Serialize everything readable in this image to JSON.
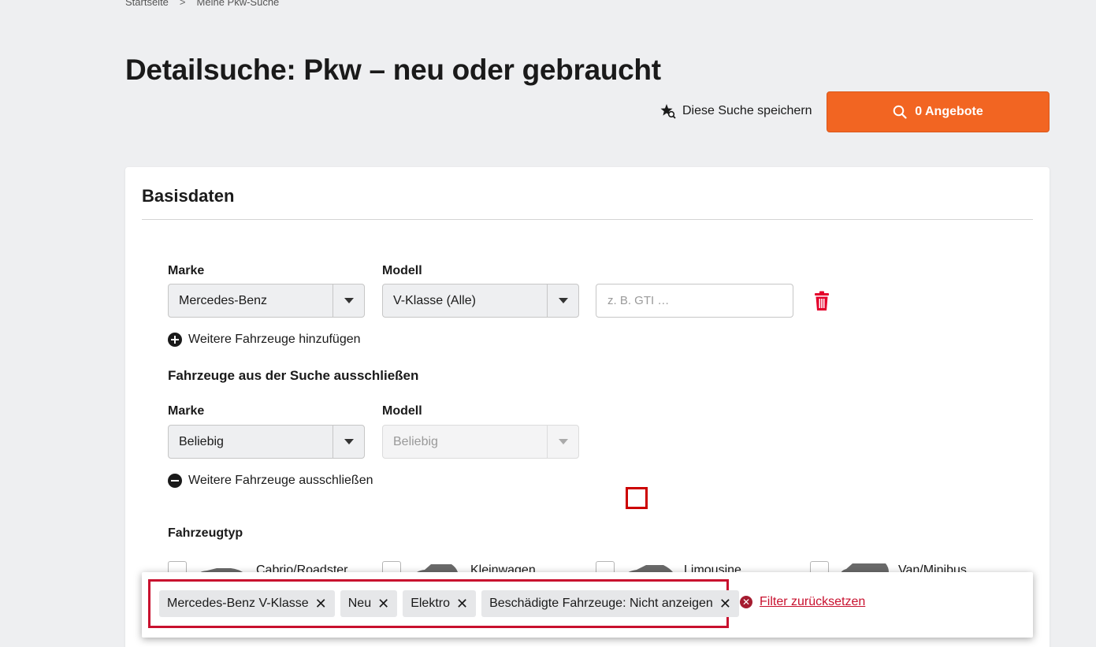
{
  "breadcrumb": {
    "home": "Startseite",
    "separator": ">",
    "current": "Meine Pkw-Suche"
  },
  "page_title": "Detailsuche: Pkw – neu oder gebraucht",
  "save_search_label": "Diese Suche speichern",
  "offers_button_label": "0 Angebote",
  "card": {
    "title": "Basisdaten",
    "include": {
      "marke_label": "Marke",
      "marke_value": "Mercedes-Benz",
      "modell_label": "Modell",
      "modell_value": "V-Klasse (Alle)",
      "variant_placeholder": "z. B. GTI …",
      "add_more_label": "Weitere Fahrzeuge hinzufügen"
    },
    "exclude": {
      "heading": "Fahrzeuge aus der Suche ausschließen",
      "marke_label": "Marke",
      "marke_value": "Beliebig",
      "modell_label": "Modell",
      "modell_value": "Beliebig",
      "exclude_more_label": "Weitere Fahrzeuge ausschließen"
    },
    "vehicle_type": {
      "heading": "Fahrzeugtyp",
      "options": [
        "Cabrio/Roadster",
        "Kleinwagen",
        "Limousine",
        "Van/Minibus"
      ]
    }
  },
  "filter_bar": {
    "chips": [
      "Mercedes-Benz V-Klasse",
      "Neu",
      "Elektro",
      "Beschädigte Fahrzeuge: Nicht anzeigen"
    ],
    "reset_label": "Filter zurücksetzen"
  },
  "colors": {
    "accent": "#f26522",
    "danger": "#c8102e",
    "trash": "#e4002b"
  }
}
